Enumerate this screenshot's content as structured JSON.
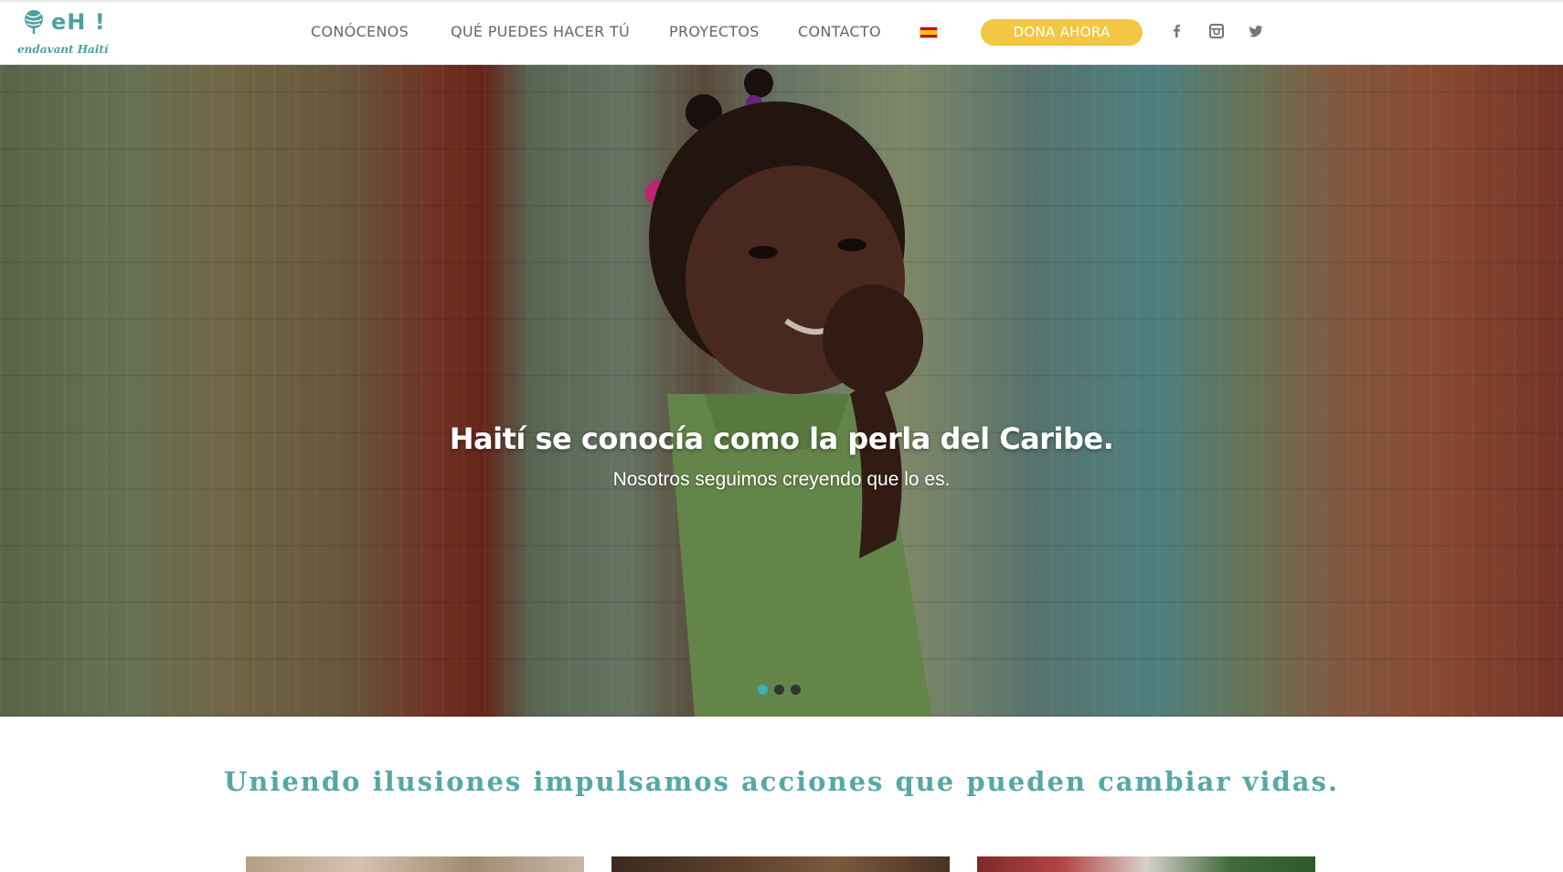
{
  "logo": {
    "main": "eH !",
    "sub": "endavant Haití",
    "icon": "leaf-icon"
  },
  "nav": {
    "items": [
      {
        "label": "CONÓCENOS"
      },
      {
        "label": "QUÉ PUEDES HACER TÚ"
      },
      {
        "label": "PROYECTOS"
      },
      {
        "label": "CONTACTO"
      }
    ],
    "language_flag": "spain-flag-icon",
    "donate_label": "DONA AHORA"
  },
  "social": {
    "facebook": "facebook-icon",
    "instagram": "instagram-icon",
    "twitter": "twitter-icon"
  },
  "hero": {
    "title": "Haití se conocía como la perla del Caribe.",
    "subtitle": "Nosotros seguimos creyendo que lo es.",
    "slides_count": 3,
    "active_slide": 1
  },
  "tagline": "Uniendo ilusiones impulsamos acciones que pueden cambiar vidas.",
  "colors": {
    "accent": "#4aa2a1",
    "donate": "#f2c744",
    "dot_active": "#3bb1b0"
  }
}
